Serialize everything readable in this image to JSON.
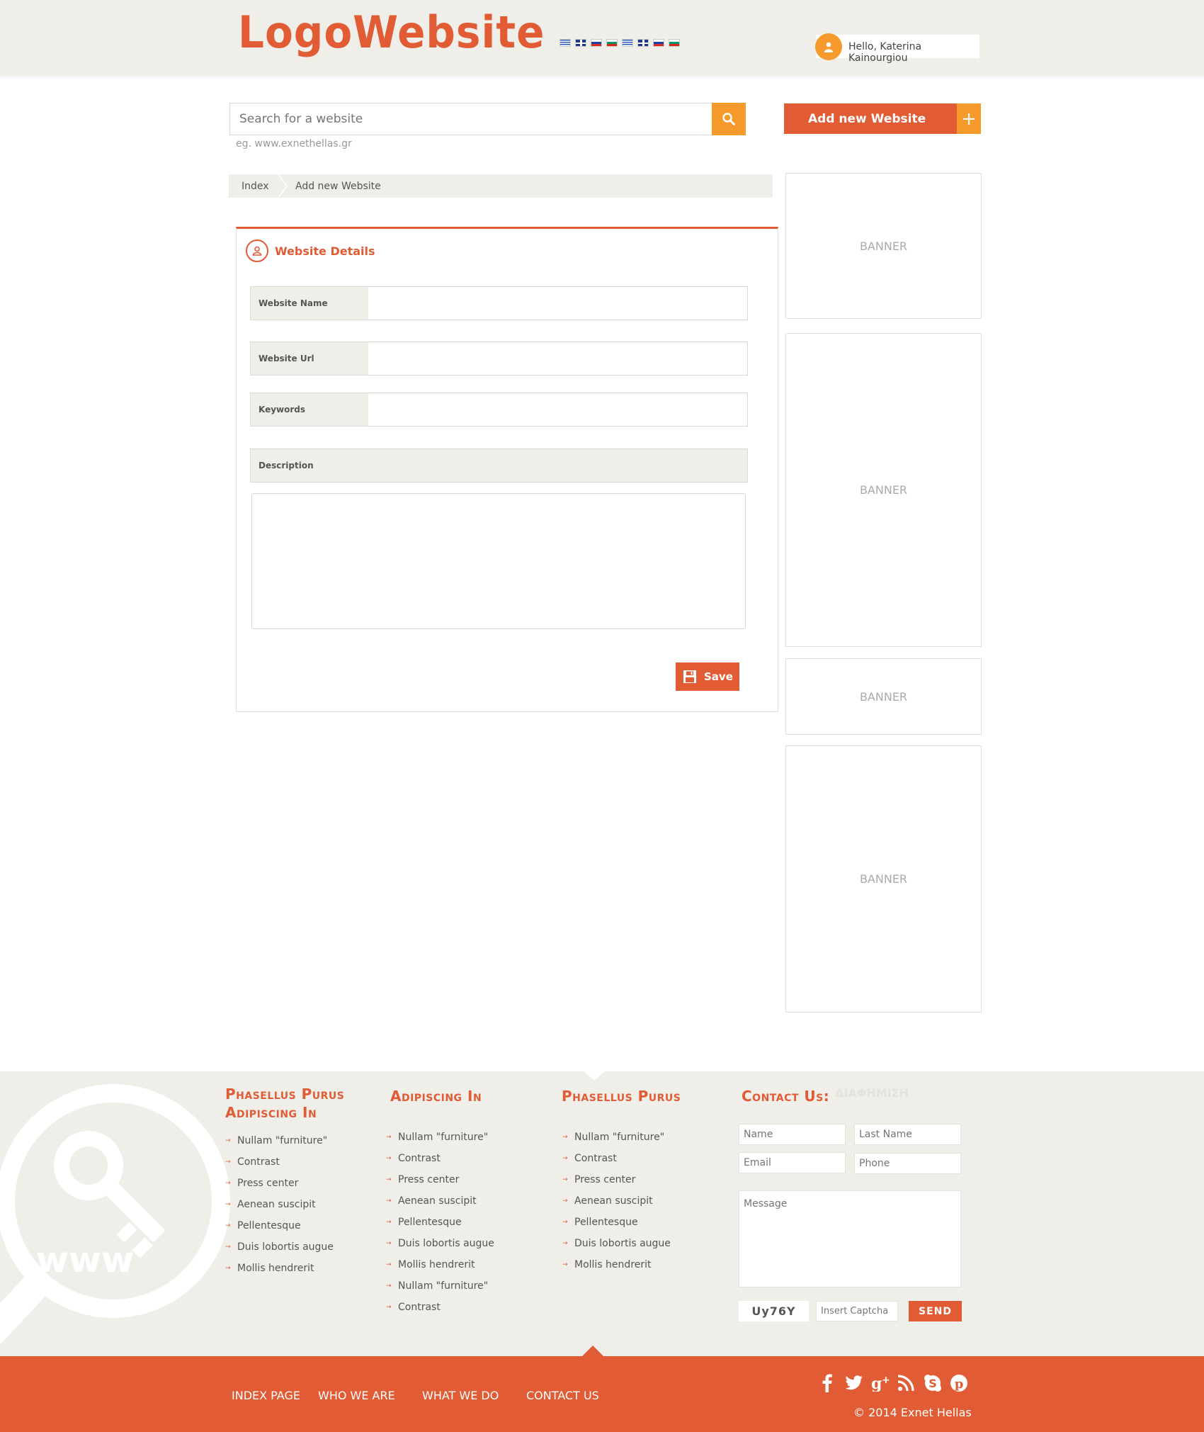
{
  "header": {
    "logo_part1": "Logo",
    "logo_part2": "Website",
    "languages": [
      "gr",
      "uk",
      "ru",
      "bg",
      "gr",
      "uk",
      "ru",
      "bg"
    ],
    "user_greeting": "Hello, Katerina Kainourgiou"
  },
  "search": {
    "placeholder": "Search for a website",
    "hint": "eg. www.exnethellas.gr"
  },
  "add_button": {
    "label": "Add  new Website",
    "plus": "+"
  },
  "breadcrumb": {
    "items": [
      "Index",
      "Add new Website"
    ]
  },
  "panel": {
    "title": "Website Details",
    "fields": [
      {
        "label": "Website Name",
        "value": ""
      },
      {
        "label": "Website Url",
        "value": ""
      },
      {
        "label": "Keywords",
        "value": ""
      }
    ],
    "description_label": "Description",
    "description_value": "",
    "save_label": "Save"
  },
  "banners": [
    "BANNER",
    "BANNER",
    "BANNER",
    "BANNER"
  ],
  "footer": {
    "columns": [
      {
        "title_line1": "Phasellus Purus",
        "title_line2": "Adipiscing In",
        "items": [
          "Nullam \"furniture\"",
          "Contrast",
          "Press center",
          "Aenean suscipit",
          "Pellentesque",
          "Duis lobortis augue",
          "Mollis hendrerit"
        ]
      },
      {
        "title_line1": "Adipiscing In",
        "items": [
          "Nullam \"furniture\"",
          "Contrast",
          "Press center",
          "Aenean suscipit",
          "Pellentesque",
          "Duis lobortis augue",
          "Mollis hendrerit",
          "Nullam \"furniture\"",
          "Contrast"
        ]
      },
      {
        "title_line1": "Phasellus Purus",
        "items": [
          "Nullam \"furniture\"",
          "Contrast",
          "Press center",
          "Aenean suscipit",
          "Pellentesque",
          "Duis lobortis augue",
          "Mollis hendrerit"
        ]
      }
    ],
    "watermark_text": "www",
    "contact": {
      "title": "Contact Us:",
      "ad_text": "ΔΙΑΦΗΜΙΣΗ",
      "name_placeholder": "Name",
      "lastname_placeholder": "Last Name",
      "email_placeholder": "Email",
      "phone_placeholder": "Phone",
      "message_placeholder": "Message",
      "captcha_code": "Uy76Y",
      "captcha_placeholder": "Insert Captcha",
      "send_label": "SEND"
    },
    "nav": [
      "INDEX PAGE",
      "WHO WE ARE",
      "WHAT WE DO",
      "CONTACT US"
    ],
    "social": [
      "facebook-icon",
      "twitter-icon",
      "google-plus-icon",
      "rss-icon",
      "skype-icon",
      "pinterest-icon"
    ],
    "copyright": "© 2014 Exnet Hellas"
  },
  "colors": {
    "accent": "#e15b34",
    "secondary": "#f59a2b",
    "background_light": "#efeee9"
  }
}
